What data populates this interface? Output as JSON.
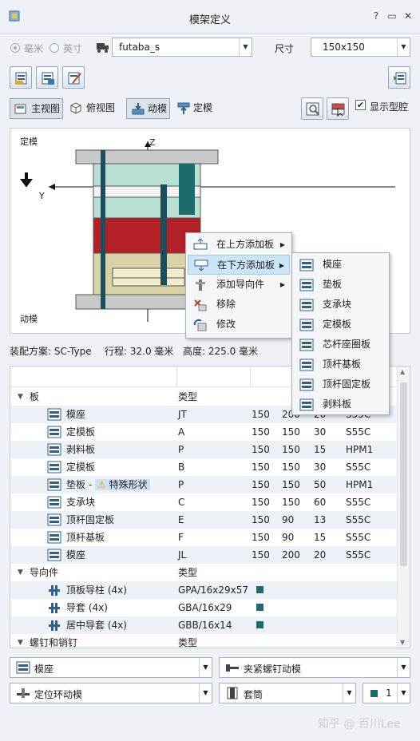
{
  "window": {
    "title": "模架定义",
    "help": "?",
    "minimize": "▭",
    "close": "✕"
  },
  "units": {
    "mm_label": "毫米",
    "inch_label": "英寸"
  },
  "vendor": {
    "value": "futaba_s"
  },
  "size": {
    "label": "尺寸",
    "value": "150x150"
  },
  "views": {
    "main": "主视图",
    "top": "俯视图",
    "moving": "动模",
    "fixed": "定模",
    "show_cavity": "显示型腔"
  },
  "preview": {
    "fixed_label": "定模",
    "moving_label": "动模",
    "z_label": "Z",
    "y_label": "Y"
  },
  "context_menu": {
    "items": [
      "在上方添加板",
      "在下方添加板",
      "添加导向件",
      "移除",
      "修改"
    ],
    "submenu": [
      "模座",
      "垫板",
      "支承块",
      "定模板",
      "芯杆座圈板",
      "顶杆基板",
      "顶杆固定板",
      "剥料板"
    ]
  },
  "info": {
    "scheme": "装配方案: SC-Type",
    "stroke": "行程: 32.0 毫米",
    "height": "高度: 225.0 毫米"
  },
  "table": {
    "groups": {
      "plates": {
        "label": "板",
        "col": "类型"
      },
      "guides": {
        "label": "导向件",
        "col": "类型"
      },
      "screws": {
        "label": "螺钉和销钉",
        "col": "类型"
      }
    },
    "plates": [
      {
        "name": "模座",
        "type": "JT",
        "a": "150",
        "b": "200",
        "c": "20",
        "mat": "S55C"
      },
      {
        "name": "定模板",
        "type": "A",
        "a": "150",
        "b": "150",
        "c": "30",
        "mat": "S55C"
      },
      {
        "name": "剥料板",
        "type": "P",
        "a": "150",
        "b": "150",
        "c": "15",
        "mat": "HPM1"
      },
      {
        "name": "定模板",
        "type": "B",
        "a": "150",
        "b": "150",
        "c": "30",
        "mat": "S55C"
      },
      {
        "name": "垫板 - ",
        "warn": "特殊形状",
        "type": "P",
        "a": "150",
        "b": "150",
        "c": "50",
        "mat": "HPM1"
      },
      {
        "name": "支承块",
        "type": "C",
        "a": "150",
        "b": "150",
        "c": "60",
        "mat": "S55C"
      },
      {
        "name": "顶杆固定板",
        "type": "E",
        "a": "150",
        "b": "90",
        "c": "13",
        "mat": "S55C"
      },
      {
        "name": "顶杆基板",
        "type": "F",
        "a": "150",
        "b": "90",
        "c": "15",
        "mat": "S55C"
      },
      {
        "name": "模座",
        "type": "JL",
        "a": "150",
        "b": "200",
        "c": "20",
        "mat": "S55C"
      }
    ],
    "guides": [
      {
        "name": "顶板导柱 (4x)",
        "type": "GPA/16x29x57"
      },
      {
        "name": "导套 (4x)",
        "type": "GBA/16x29"
      },
      {
        "name": "居中导套 (4x)",
        "type": "GBB/16x14"
      }
    ]
  },
  "footer": {
    "plate_select": "模座",
    "screw_select": "夹紧螺钉动模",
    "locate_select": "定位环动模",
    "sleeve_select": "套筒",
    "count": "1"
  },
  "watermark": "知乎 @ 百川Lee",
  "colors": {
    "accent": "#1c6b6d",
    "plate_teal": "#b8e0d2",
    "plate_red": "#b32026",
    "plate_khaki": "#d8d2a6"
  }
}
